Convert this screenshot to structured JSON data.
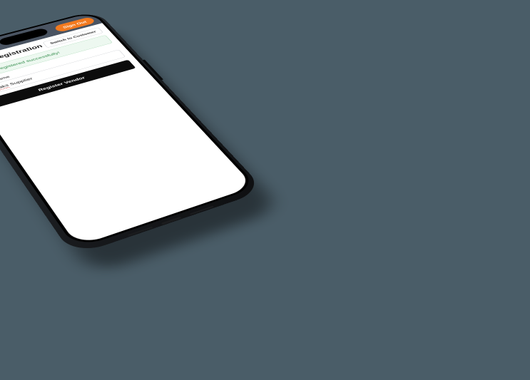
{
  "header": {
    "sign_out_label": "Sign Out"
  },
  "page": {
    "title": "Vendor Registration",
    "switch_label": "Switch to Customer"
  },
  "alert": {
    "message": "Vendor registered successfully!"
  },
  "form": {
    "vendor_name_label": "Vendor Name",
    "vendor_name_value_part1": "NikNaks",
    "vendor_name_value_part2": " Supplier",
    "vendor_name_value_full": "NikNaks Supplier",
    "submit_label": "Register Vendor"
  },
  "colors": {
    "accent_orange": "#f37a1f",
    "success_green": "#3aa657",
    "header_bg": "#4a5462",
    "primary_black": "#0c0c0c"
  }
}
